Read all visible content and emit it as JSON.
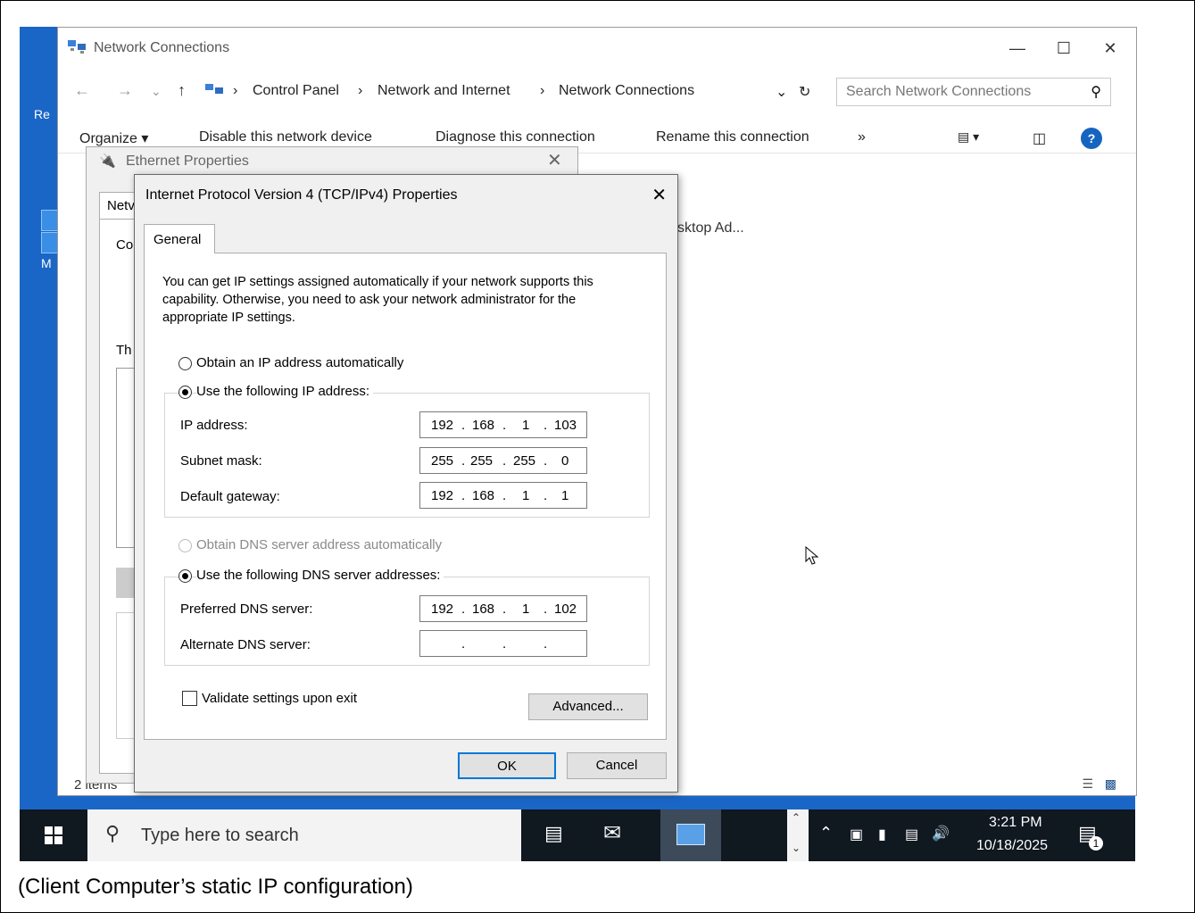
{
  "desktop": {
    "label_re": "Re",
    "label_m": "M"
  },
  "explorer": {
    "title": "Network Connections",
    "breadcrumbs": [
      "Control Panel",
      "Network and Internet",
      "Network Connections"
    ],
    "search_placeholder": "Search Network Connections",
    "commands": [
      "Organize ▾",
      "Disable this network device",
      "Diagnose this connection",
      "Rename this connection",
      "»"
    ],
    "item_partial": "sktop Ad...",
    "status": "2 items"
  },
  "ethernet_dialog": {
    "title": "Ethernet Properties",
    "tab_partial": "Netv",
    "label_co": "Co",
    "label_th": "Th"
  },
  "ipv4_dialog": {
    "title": "Internet Protocol Version 4 (TCP/IPv4) Properties",
    "tab": "General",
    "description": "You can get IP settings assigned automatically if your network supports this capability. Otherwise, you need to ask your network administrator for the appropriate IP settings.",
    "radio_auto_ip": "Obtain an IP address automatically",
    "radio_manual_ip": "Use the following IP address:",
    "ip_label": "IP address:",
    "ip_value": [
      "192",
      "168",
      "1",
      "103"
    ],
    "subnet_label": "Subnet mask:",
    "subnet_value": [
      "255",
      "255",
      "255",
      "0"
    ],
    "gateway_label": "Default gateway:",
    "gateway_value": [
      "192",
      "168",
      "1",
      "1"
    ],
    "radio_auto_dns": "Obtain DNS server address automatically",
    "radio_manual_dns": "Use the following DNS server addresses:",
    "pref_dns_label": "Preferred DNS server:",
    "pref_dns_value": [
      "192",
      "168",
      "1",
      "102"
    ],
    "alt_dns_label": "Alternate DNS server:",
    "alt_dns_value": [
      "",
      "",
      "",
      ""
    ],
    "validate_label": "Validate settings upon exit",
    "advanced_button": "Advanced...",
    "ok_button": "OK",
    "cancel_button": "Cancel"
  },
  "taskbar": {
    "search_placeholder": "Type here to search",
    "time": "3:21 PM",
    "date": "10/18/2025",
    "notification_count": "1"
  },
  "caption": "(Client Computer’s static IP configuration)"
}
